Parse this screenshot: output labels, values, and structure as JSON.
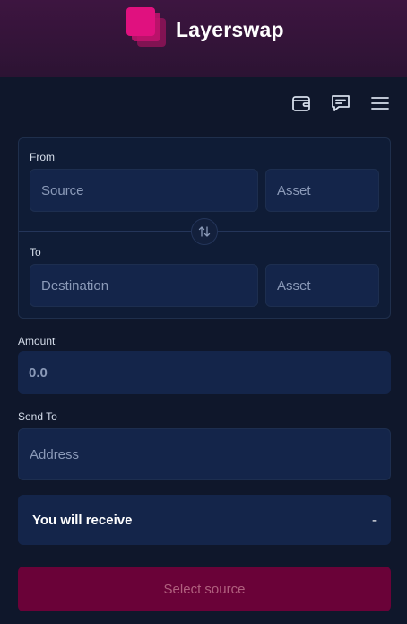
{
  "header": {
    "brand": "Layerswap"
  },
  "toolbar": {
    "icons": [
      "wallet-icon",
      "chat-icon",
      "menu-icon"
    ]
  },
  "swap": {
    "from_label": "From",
    "source_placeholder": "Source",
    "from_asset_placeholder": "Asset",
    "to_label": "To",
    "destination_placeholder": "Destination",
    "to_asset_placeholder": "Asset"
  },
  "amount": {
    "label": "Amount",
    "placeholder": "0.0"
  },
  "send_to": {
    "label": "Send To",
    "placeholder": "Address"
  },
  "receive": {
    "label": "You will receive",
    "value": "-"
  },
  "submit": {
    "label": "Select source"
  },
  "colors": {
    "brand_pink": "#e0117f",
    "background": "#0f172b",
    "field": "#14254a",
    "submit_disabled": "#6a0238"
  }
}
